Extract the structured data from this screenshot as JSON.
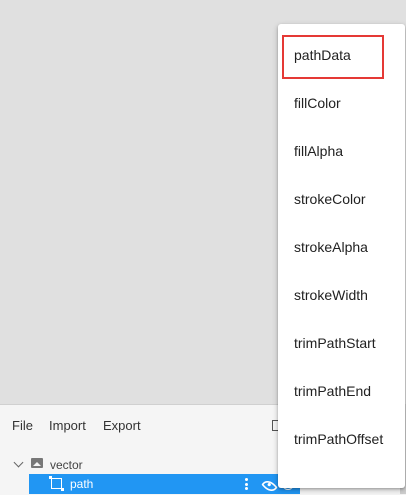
{
  "toolbar": {
    "file_label": "File",
    "import_label": "Import",
    "export_label": "Export"
  },
  "layers": {
    "vector_label": "vector",
    "path_label": "path"
  },
  "dropdown": {
    "items": [
      {
        "label": "pathData"
      },
      {
        "label": "fillColor"
      },
      {
        "label": "fillAlpha"
      },
      {
        "label": "strokeColor"
      },
      {
        "label": "strokeAlpha"
      },
      {
        "label": "strokeWidth"
      },
      {
        "label": "trimPathStart"
      },
      {
        "label": "trimPathEnd"
      },
      {
        "label": "trimPathOffset"
      }
    ]
  },
  "colors": {
    "selection": "#2196f3",
    "highlight_border": "#e53935",
    "canvas": "#e0e0e0"
  }
}
